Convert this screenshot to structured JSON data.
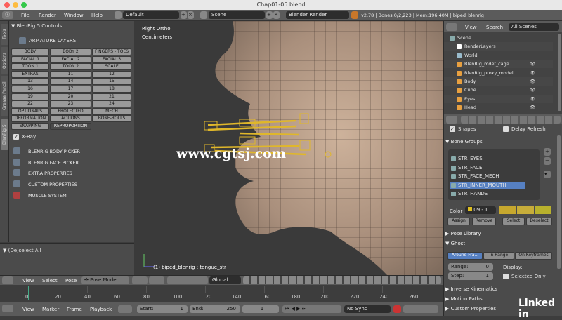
{
  "window": {
    "title": "Chap01-05.blend"
  },
  "menubar": {
    "items": [
      "File",
      "Render",
      "Window",
      "Help"
    ],
    "layout": "Default",
    "scene": "Scene",
    "engine": "Blender Render",
    "stats": "v2.78 | Bones:0/2,223 | Mem:196.40M | biped_blenrig"
  },
  "side_tabs": [
    "Tools",
    "Options",
    "Grease Pencil",
    "BlenRig 5"
  ],
  "left_panel": {
    "header": "BlenRig 5 Controls",
    "armature_layers": "ARMATURE LAYERS",
    "grid": [
      [
        "BODY",
        "BODY 2",
        "FINGERS - TOES"
      ],
      [
        "FACIAL 1",
        "FACIAL 2",
        "FACIAL 3"
      ],
      [
        "TOON 1",
        "TOON 2",
        "SCALE"
      ],
      [
        "EXTRAS",
        "11",
        "12"
      ],
      [
        "13",
        "14",
        "15"
      ],
      [
        "16",
        "17",
        "18"
      ],
      [
        "19",
        "20",
        "21"
      ],
      [
        "22",
        "23",
        "24"
      ],
      [
        "OPTIONALS",
        "PROTECTED",
        "MECH"
      ],
      [
        "DEFORMATION",
        "ACTIONS",
        "BONE-ROLLS"
      ]
    ],
    "last_row": [
      "SNAPPING",
      "REPROPORTION"
    ],
    "xray": "X-Ray",
    "menu": [
      "BLENRIG BODY PICKER",
      "BLENRIG FACE PICKER",
      "EXTRA PROPERTIES",
      "CUSTOM PROPERTIES",
      "MUSCLE SYSTEM"
    ],
    "deselect": "(De)select All"
  },
  "viewport": {
    "view": "Right Ortho",
    "units": "Centimeters",
    "status": "(1) biped_blenrig : tongue_str",
    "watermark": "www.cgtsj.com"
  },
  "viewport_header": {
    "items": [
      "View",
      "Select",
      "Pose"
    ],
    "mode": "Pose Mode",
    "orientation": "Global"
  },
  "timeline": {
    "ticks": [
      "0",
      "20",
      "40",
      "60",
      "80",
      "100",
      "120",
      "140",
      "160",
      "180",
      "200",
      "220",
      "240",
      "260"
    ],
    "items": [
      "View",
      "Marker",
      "Frame",
      "Playback"
    ],
    "start": "Start:",
    "start_val": "1",
    "end": "End:",
    "end_val": "250",
    "frame": "1",
    "sync": "No Sync"
  },
  "outliner": {
    "view": "View",
    "search": "Search",
    "filter": "All Scenes",
    "rows": [
      "Scene",
      "RenderLayers",
      "World",
      "BlenRig_mdef_cage",
      "BlenRig_proxy_model",
      "Body",
      "Cube",
      "Eyes",
      "Head"
    ]
  },
  "props": {
    "shapes": "Shapes",
    "delay": "Delay Refresh",
    "bone_groups": "Bone Groups",
    "groups": [
      "STR_EYES",
      "STR_FACE",
      "STR_FACE_MECH",
      "STR_INNER_MOUTH",
      "STR_HANDS"
    ],
    "color_label": "Color",
    "color_value": "09 - T",
    "assign": "Assign",
    "remove": "Remove",
    "select": "Select",
    "deselect": "Deselect",
    "pose_library": "Pose Library",
    "ghost": "Ghost",
    "ghost_tabs": [
      "Around Fra...",
      "In Range",
      "On Keyframes"
    ],
    "range_label": "Range:",
    "range_val": "0",
    "step_label": "Step:",
    "step_val": "1",
    "display": "Display:",
    "selected_only": "Selected Only",
    "sections": [
      "Inverse Kinematics",
      "Motion Paths",
      "Custom Properties"
    ]
  },
  "logo": "Linked in"
}
